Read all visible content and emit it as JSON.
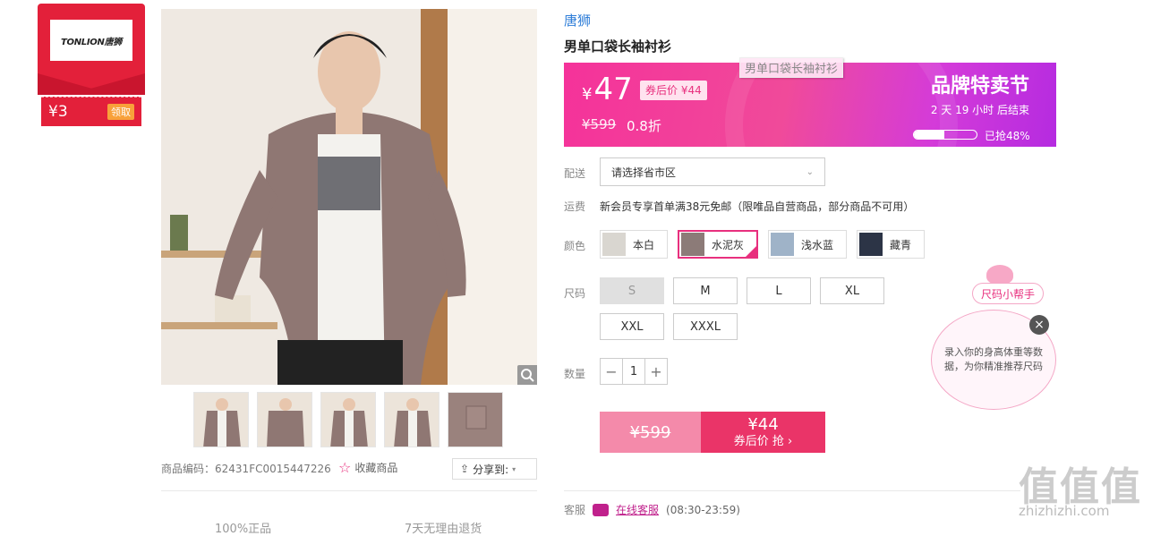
{
  "coupon": {
    "brand_logo_text": "TONLION唐狮",
    "amount": "¥3",
    "claim_label": "领取"
  },
  "gallery": {
    "product_code_label": "商品编码：",
    "product_code": "62431FC0015447226",
    "favorite_label": "收藏商品",
    "share_label": "分享到:"
  },
  "product": {
    "brand": "唐狮",
    "title": "男单口袋长袖衬衫",
    "floating_label": "男单口袋长袖衬衫"
  },
  "price_banner": {
    "currency": "¥",
    "price": "47",
    "after_coupon_tag": "券后价 ¥44",
    "original_price": "¥599",
    "discount": "0.8折",
    "sale_title": "品牌特卖节",
    "countdown": "2 天 19 小时 后结束",
    "sold_fraction": 0.48,
    "sold_text": "已抢48%"
  },
  "delivery": {
    "label": "配送",
    "placeholder": "请选择省市区"
  },
  "shipping": {
    "label": "运费",
    "text": "新会员专享首单满38元免邮（限唯品自营商品，部分商品不可用）"
  },
  "colors": {
    "label": "颜色",
    "options": [
      {
        "name": "本白",
        "swatch": "#d9d6d0",
        "selected": false
      },
      {
        "name": "水泥灰",
        "swatch": "#8c7b78",
        "selected": true
      },
      {
        "name": "浅水蓝",
        "swatch": "#9fb3c8",
        "selected": false
      },
      {
        "name": "藏青",
        "swatch": "#2c3446",
        "selected": false
      }
    ]
  },
  "sizes": {
    "label": "尺码",
    "options": [
      {
        "name": "S",
        "disabled": true
      },
      {
        "name": "M",
        "disabled": false
      },
      {
        "name": "L",
        "disabled": false
      },
      {
        "name": "XL",
        "disabled": false
      },
      {
        "name": "XXL",
        "disabled": false
      },
      {
        "name": "XXXL",
        "disabled": false
      }
    ]
  },
  "quantity": {
    "label": "数量",
    "value": "1",
    "minus": "−",
    "plus": "+"
  },
  "buy": {
    "original_price": "¥599",
    "after_price": "¥44",
    "after_label": "券后价 抢 ›"
  },
  "service": {
    "label": "客服",
    "link": "在线客服",
    "hours": "(08:30-23:59)"
  },
  "size_helper": {
    "tag": "尺码小帮手",
    "text": "录入你的身高体重等数据，为你精准推荐尺码",
    "close": "×"
  },
  "bottom_features": {
    "item1": "100%正品",
    "item2": "7天无理由退货"
  },
  "watermark": {
    "text": "值值值",
    "url": "zhizhizhi.com"
  },
  "colors_theme": {
    "accent_pink": "#e8307e",
    "brand_blue": "#2f7ed8",
    "coupon_red": "#e3203a"
  }
}
